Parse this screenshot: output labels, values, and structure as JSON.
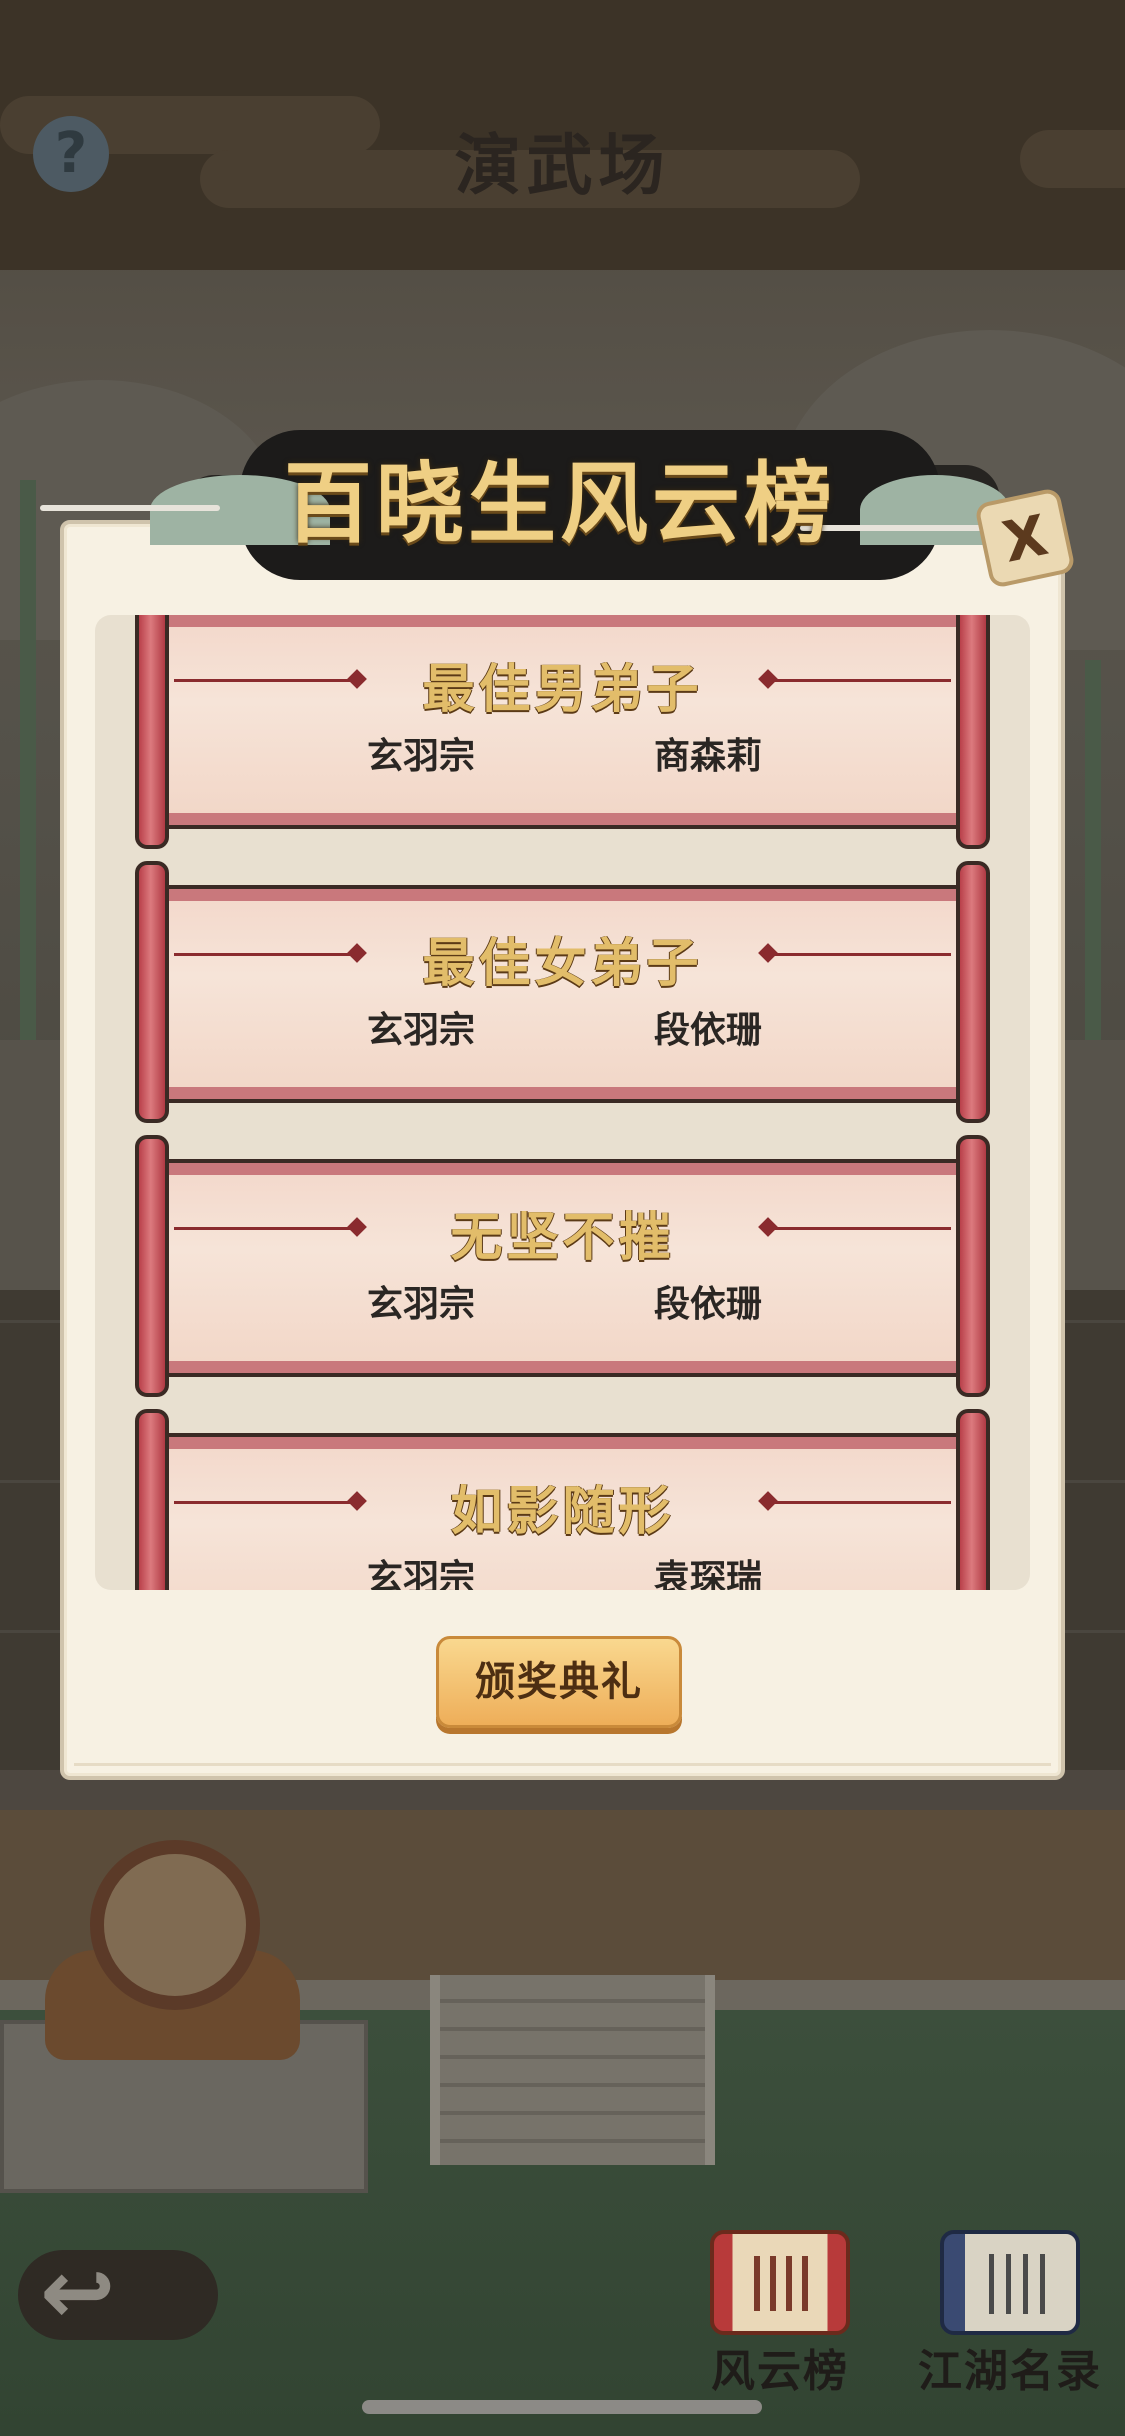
{
  "header": {
    "help_icon": "?",
    "title": "演武场"
  },
  "modal": {
    "title": "百晓生风云榜",
    "close_icon": "X",
    "awards": [
      {
        "name": "最佳男弟子",
        "sect": "玄羽宗",
        "winner": "商森莉"
      },
      {
        "name": "最佳女弟子",
        "sect": "玄羽宗",
        "winner": "段依珊"
      },
      {
        "name": "无坚不摧",
        "sect": "玄羽宗",
        "winner": "段依珊"
      },
      {
        "name": "如影随形",
        "sect": "玄羽宗",
        "winner": "袁琛瑞"
      }
    ],
    "ceremony_button": "颁奖典礼"
  },
  "bottom_nav": {
    "back_icon": "↩",
    "items": [
      {
        "label": "风云榜",
        "icon": "ranking-scroll-icon"
      },
      {
        "label": "江湖名录",
        "icon": "book-icon"
      }
    ]
  }
}
